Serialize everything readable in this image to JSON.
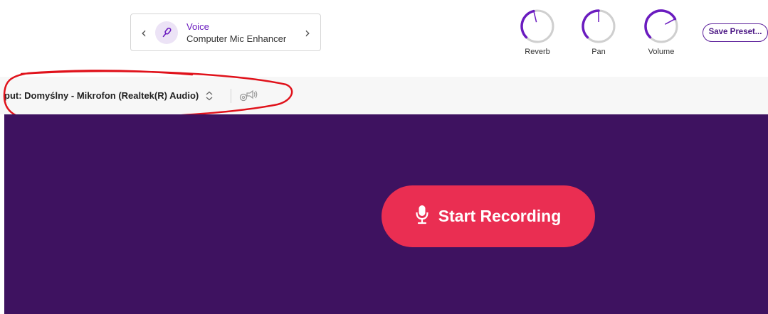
{
  "preset": {
    "category": "Voice",
    "name": "Computer Mic Enhancer",
    "prev_icon": "chevron-left-icon",
    "next_icon": "chevron-right-icon",
    "icon": "microphone-icon"
  },
  "knobs": [
    {
      "label": "Reverb",
      "value_fraction": 0.45
    },
    {
      "label": "Pan",
      "value_fraction": 0.5
    },
    {
      "label": "Volume",
      "value_fraction": 0.73
    }
  ],
  "save_preset": {
    "label": "Save Preset..."
  },
  "input": {
    "label": "put: Domyślny - Mikrofon (Realtek(R) Audio)",
    "select_icon": "updown-chevron-icon",
    "monitor_icon": "speaker-settings-icon"
  },
  "record": {
    "label": "Start Recording",
    "icon": "microphone-icon"
  },
  "colors": {
    "accent_purple": "#6a1bbf",
    "stage_bg": "#3e1260",
    "record_red": "#ea2e52",
    "annotation_red": "#e0121b"
  }
}
